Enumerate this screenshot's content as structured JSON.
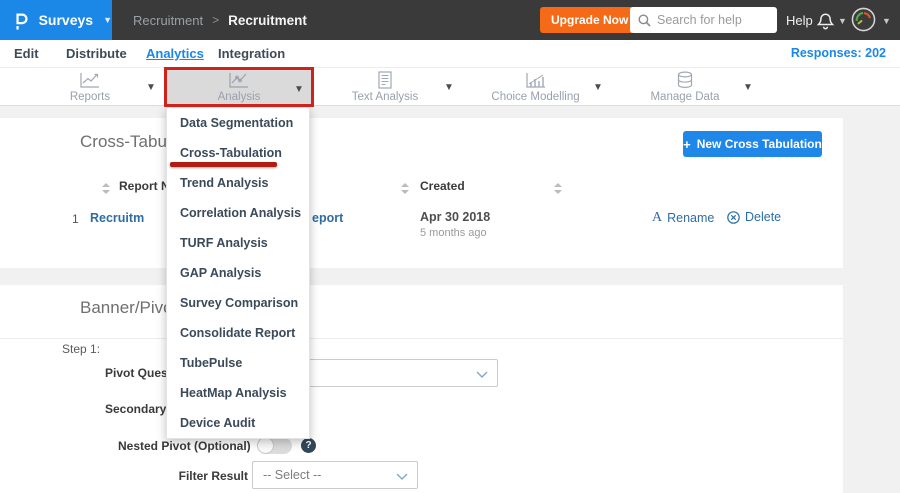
{
  "topbar": {
    "product": "Surveys",
    "breadcrumb": [
      "Recruitment",
      "Recruitment"
    ],
    "breadcrumb_sep": ">",
    "upgrade_label": "Upgrade Now",
    "search_placeholder": "Search for help",
    "help_label": "Help"
  },
  "subnav": {
    "items": [
      "Edit",
      "Distribute",
      "Analytics",
      "Integration"
    ],
    "active_item": "Analytics",
    "responses_label": "Responses: 202"
  },
  "toolbar": {
    "items": [
      {
        "label": "Reports",
        "icon": "line-chart-icon"
      },
      {
        "label": "Analysis",
        "icon": "analysis-chart-icon",
        "highlighted": true
      },
      {
        "label": "Text Analysis",
        "icon": "document-icon"
      },
      {
        "label": "Choice Modelling",
        "icon": "bar-line-chart-icon"
      },
      {
        "label": "Manage Data",
        "icon": "database-icon"
      }
    ]
  },
  "menu": {
    "items": [
      "Data Segmentation",
      "Cross-Tabulation",
      "Trend Analysis",
      "Correlation Analysis",
      "TURF Analysis",
      "GAP Analysis",
      "Survey Comparison",
      "Consolidate Report",
      "TubePulse",
      "HeatMap Analysis",
      "Device Audit"
    ],
    "annotated_item": "Cross-Tabulation"
  },
  "crosstab": {
    "title_visible": "Cross-Tabula",
    "button_plus": "+",
    "button_label": "New Cross Tabulation",
    "col_report_visible": "Report Na",
    "col_created": "Created",
    "row": {
      "num": "1",
      "name_visible_left": "Recruitm",
      "name_visible_right": "eport",
      "created_date": "Apr 30 2018",
      "created_ago": "5 months ago",
      "rename_icon_glyph": "A",
      "rename_label": "Rename",
      "delete_label": "Delete"
    }
  },
  "banner": {
    "title_visible": "Banner/Pivo",
    "step_label": "Step 1:",
    "pivot_label_visible": "Pivot Ques",
    "secondary_label_visible": "Secondary",
    "nested_label": "Nested Pivot (Optional)",
    "filter_label": "Filter Result",
    "filter_value": "-- Select --"
  },
  "colors": {
    "brand_blue": "#1b87e6",
    "topbar_dark": "#3a3a3a",
    "upgrade_orange": "#f56a16",
    "annotation_red": "#ce231c",
    "link_blue": "#2d6da3",
    "page_bg": "#f1f1f1"
  }
}
